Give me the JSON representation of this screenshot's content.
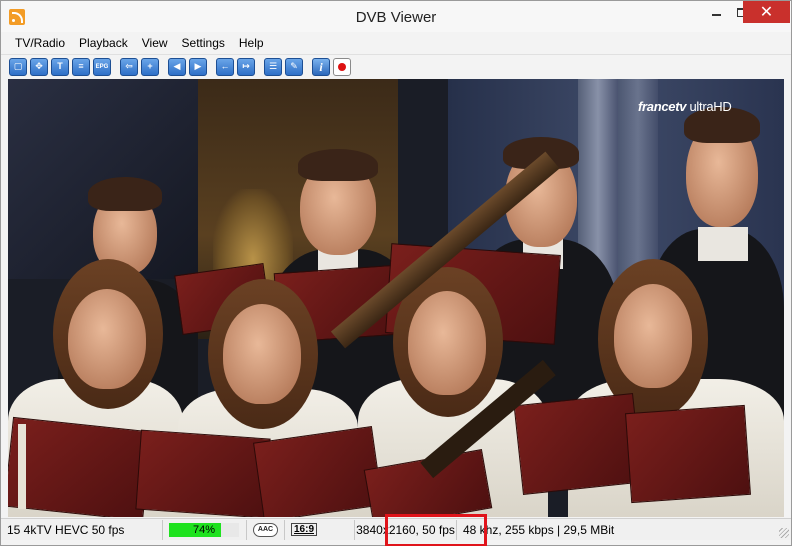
{
  "window": {
    "title": "DVB Viewer"
  },
  "title_bar": {
    "close_glyph": "✕"
  },
  "menu": {
    "items": [
      "TV/Radio",
      "Playback",
      "View",
      "Settings",
      "Help"
    ]
  },
  "toolbar": {
    "buttons": [
      {
        "name": "fullscreen-icon",
        "glyph": "▢"
      },
      {
        "name": "options-icon",
        "glyph": "✥"
      },
      {
        "name": "teletext-icon",
        "glyph": "T"
      },
      {
        "name": "osd-icon",
        "glyph": "≡"
      },
      {
        "name": "epg-icon",
        "glyph": "EPG"
      },
      {
        "name": "channel-prev-icon",
        "glyph": "⇦"
      },
      {
        "name": "channel-add-icon",
        "glyph": "+"
      },
      {
        "name": "rewind-icon",
        "glyph": "◀"
      },
      {
        "name": "forward-icon",
        "glyph": "▶"
      },
      {
        "name": "back-icon",
        "glyph": "←"
      },
      {
        "name": "skip-icon",
        "glyph": "↦"
      },
      {
        "name": "list-icon",
        "glyph": "☰"
      },
      {
        "name": "tools-icon",
        "glyph": "✎"
      },
      {
        "name": "info-icon",
        "glyph": "i"
      },
      {
        "name": "record-icon",
        "glyph": ""
      }
    ]
  },
  "video": {
    "logo_main": "francetv",
    "logo_suffix": " ultraHD"
  },
  "status": {
    "channel": "15 4kTV HEVC 50 fps",
    "signal_percent": 74,
    "signal_label": "74%",
    "audio_format": "AAC",
    "aspect": "16:9",
    "resolution": "3840x2160, 50 fps",
    "stream_info": "48 khz, 255 kbps | 29,5 MBit"
  },
  "colors": {
    "signal_fill": "#1fe21f",
    "highlight": "#e0141b",
    "close_button": "#c9302c"
  }
}
